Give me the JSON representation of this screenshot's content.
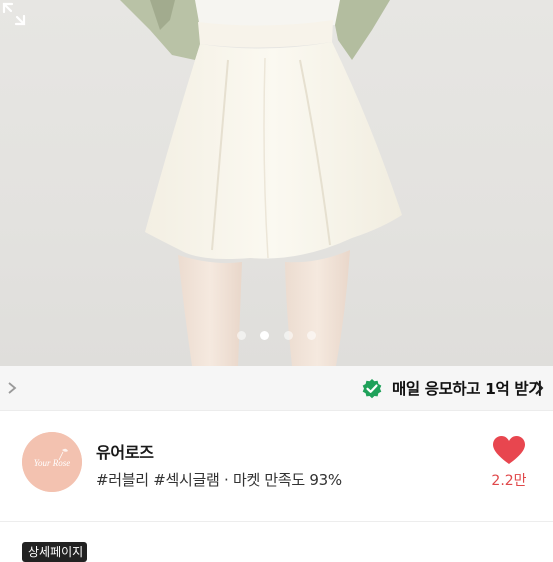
{
  "hero": {
    "pagination": {
      "count": 4,
      "active_index": 1
    },
    "expand_icon": "expand-arrows-icon"
  },
  "promo_bar": {
    "text": "매일 응모하고 1억 받기",
    "check_icon": "check-badge-icon",
    "accent": "#1fa15a"
  },
  "shop": {
    "name": "유어로즈",
    "avatar_text": "Your Rose",
    "tags": [
      "#러블리",
      "#섹시글램"
    ],
    "separator": "·",
    "satisfaction": "마켓 만족도 93%",
    "like_count": "2.2만",
    "heart_color": "#e8464f"
  },
  "bottom": {
    "badge_text": "상세페이지"
  }
}
